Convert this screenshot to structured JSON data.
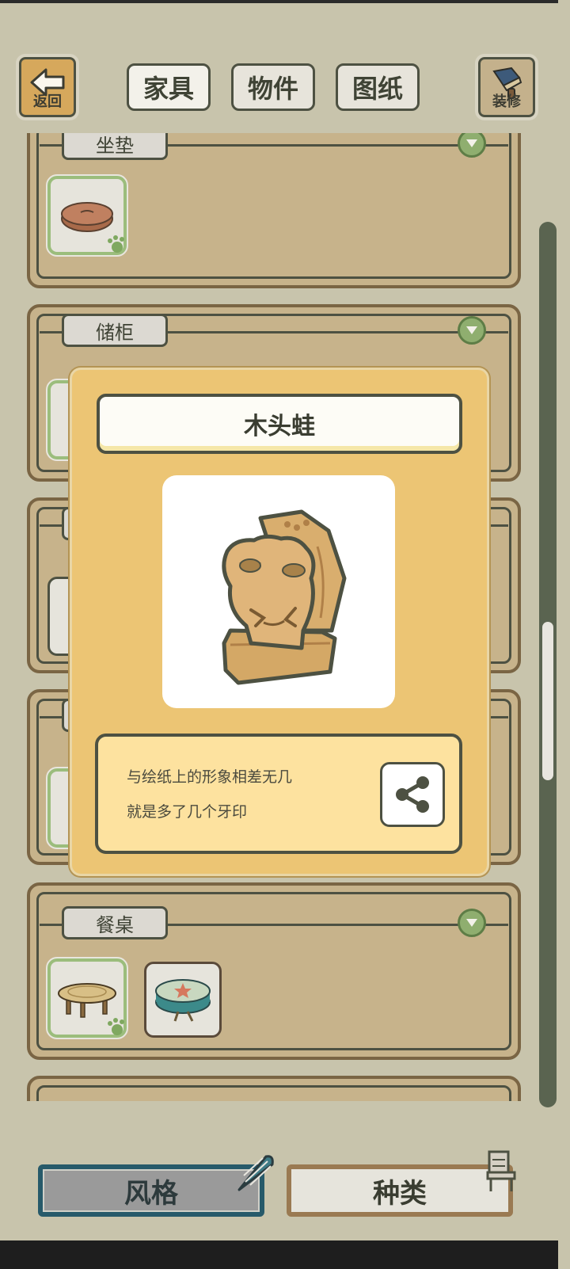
{
  "top_bar": {
    "back_label": "返回",
    "tabs": [
      "家具",
      "物件",
      "图纸"
    ],
    "active_tab": 0,
    "decorate_label": "装修"
  },
  "sections": [
    {
      "label": "坐垫",
      "items": [
        {
          "name": "round-cushion",
          "owned": true
        }
      ]
    },
    {
      "label": "储柜",
      "items": [
        {
          "name": "cabinet",
          "owned": true
        }
      ]
    },
    {
      "label": "",
      "items": [
        {
          "name": "item",
          "owned": false
        }
      ]
    },
    {
      "label": "",
      "items": [
        {
          "name": "item",
          "owned": true
        }
      ]
    },
    {
      "label": "餐桌",
      "items": [
        {
          "name": "wooden-round-table",
          "owned": true
        },
        {
          "name": "teal-star-table",
          "owned": false
        }
      ]
    }
  ],
  "popup": {
    "title": "木头蛙",
    "description_line1": "与绘纸上的形象相差无几",
    "description_line2": "就是多了几个牙印"
  },
  "bottom_tabs": {
    "style_label": "风格",
    "kind_label": "种类",
    "active": "style"
  },
  "colors": {
    "background": "#c8c4ac",
    "popup_bg": "#ecc574",
    "accent_green": "#8fae6f",
    "panel_wood": "#c7b38b"
  }
}
